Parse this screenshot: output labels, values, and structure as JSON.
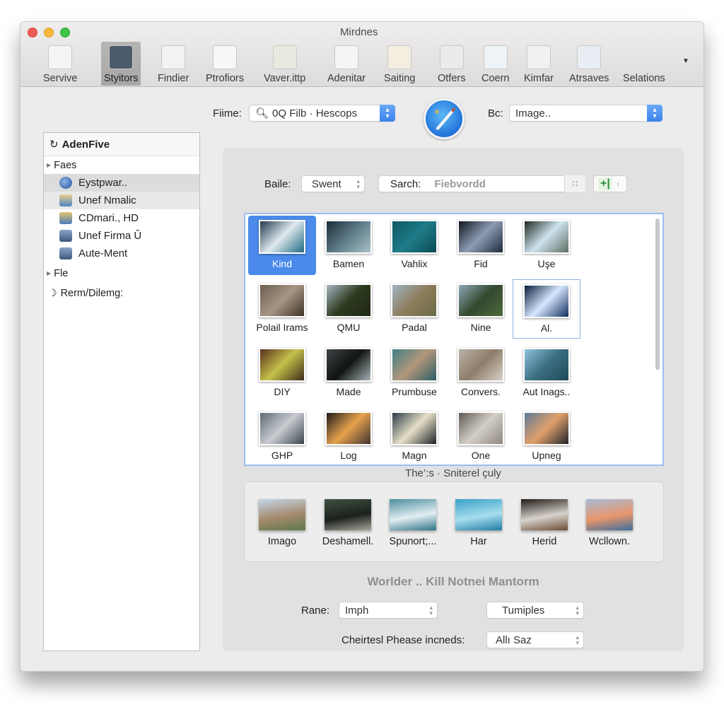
{
  "window": {
    "title": "Mirdnes",
    "traffic_lights": [
      "close",
      "minimize",
      "maximize"
    ]
  },
  "toolbar": {
    "items": [
      {
        "label": "Servive",
        "icon": "document-icon",
        "active": false
      },
      {
        "label": "Styitors",
        "icon": "folder-icon",
        "active": true
      },
      {
        "label": "Findier",
        "icon": "file-list-icon",
        "active": false
      },
      {
        "label": "Ptrofiors",
        "icon": "window-icon",
        "active": false
      },
      {
        "label": "Vaver.ittp",
        "icon": "bag-icon",
        "active": false
      },
      {
        "label": "Adenitar",
        "icon": "notes-icon",
        "active": false
      },
      {
        "label": "Saiting",
        "icon": "palette-icon",
        "active": false
      },
      {
        "label": "Otfers",
        "icon": "envelope-icon",
        "active": false
      },
      {
        "label": "Coern",
        "icon": "presentation-icon",
        "active": false
      },
      {
        "label": "Kimfar",
        "icon": "badge-icon",
        "active": false
      },
      {
        "label": "Atrsaves",
        "icon": "crosshair-icon",
        "active": false
      },
      {
        "label": "Selations",
        "icon": "",
        "active": false
      }
    ],
    "overflow_icon": "chevron-down-icon"
  },
  "filters": {
    "file_label": "Fiime:",
    "file_value": "0Q Filb · Hescops",
    "file_icon": "search-icon",
    "app_icon": "brush-badge-icon",
    "bc_label": "Bc:",
    "bc_value": "Image..",
    "baile_label": "Baile:",
    "baile_value": "Swent",
    "search_label": "Sarch:",
    "search_placeholder": "Fiebvordd",
    "search_icon": "grid-dots-icon",
    "add_button_label": "+|"
  },
  "sidebar": {
    "header": "AdenFive",
    "header_icon": "refresh-icon",
    "groups": [
      {
        "label": "Faes",
        "items": [
          {
            "label": "Eystpwar..",
            "icon": "globe-icon",
            "state": "selected"
          },
          {
            "label": "Unef Nmalic",
            "icon": "folder-icon",
            "state": "highlight"
          },
          {
            "label": "CDmari., HD",
            "icon": "drive-icon",
            "state": ""
          },
          {
            "label": "Unef Firma Ǔ",
            "icon": "disk-icon",
            "state": ""
          },
          {
            "label": "Aute-Ment",
            "icon": "disk-icon",
            "state": ""
          }
        ]
      },
      {
        "label": "Fle",
        "items": []
      }
    ],
    "footer_item": {
      "label": "Rerm/Dilemg:",
      "icon": "moon-icon"
    }
  },
  "grid": {
    "items": [
      {
        "label": "Kind",
        "colors": [
          "#21394f",
          "#dfe9ee",
          "#1e6a80"
        ],
        "state": "selected"
      },
      {
        "label": "Bamen",
        "colors": [
          "#1c2c38",
          "#5d7c88",
          "#a8c0c6"
        ],
        "state": ""
      },
      {
        "label": "Vahlix",
        "colors": [
          "#0f5664",
          "#1e7c88",
          "#0c4a56"
        ],
        "state": ""
      },
      {
        "label": "Fid",
        "colors": [
          "#10161f",
          "#8d9cb3",
          "#1c2b3c"
        ],
        "state": ""
      },
      {
        "label": "Uşe",
        "colors": [
          "#1c2a1e",
          "#cfe2ef",
          "#5b7061"
        ],
        "state": ""
      },
      {
        "label": "Polail Irams",
        "colors": [
          "#6b5e50",
          "#a69684",
          "#3e3326"
        ],
        "state": ""
      },
      {
        "label": "QMU",
        "colors": [
          "#a7b7c1",
          "#2e3a1f",
          "#1e2614"
        ],
        "state": ""
      },
      {
        "label": "Padal",
        "colors": [
          "#9fb3c4",
          "#8e7d5c",
          "#6a6a45"
        ],
        "state": ""
      },
      {
        "label": "Nine",
        "colors": [
          "#8ea7b7",
          "#33482f",
          "#4f6b3a"
        ],
        "state": ""
      },
      {
        "label": "Al.",
        "colors": [
          "#071b3a",
          "#d6e6ff",
          "#0e2e5c"
        ],
        "state": "outlined"
      },
      {
        "label": "DIY",
        "colors": [
          "#5a2f1f",
          "#c5c14a",
          "#3d2a1a"
        ],
        "state": ""
      },
      {
        "label": "Made",
        "colors": [
          "#3e4447",
          "#111511",
          "#a7b3b8"
        ],
        "state": ""
      },
      {
        "label": "Prumbuse",
        "colors": [
          "#3d7e84",
          "#b3977c",
          "#2a5d64"
        ],
        "state": ""
      },
      {
        "label": "Convers.",
        "colors": [
          "#b8b2a7",
          "#8f7d6b",
          "#d7d0c6"
        ],
        "state": ""
      },
      {
        "label": "Aut Inags..",
        "colors": [
          "#8ec2df",
          "#3b6e80",
          "#1f4958"
        ],
        "state": ""
      },
      {
        "label": "GHP",
        "colors": [
          "#5f6b74",
          "#c9ccd1",
          "#3a444c"
        ],
        "state": ""
      },
      {
        "label": "Log",
        "colors": [
          "#1d1a1a",
          "#e7a24c",
          "#3e3431"
        ],
        "state": ""
      },
      {
        "label": "Magn",
        "colors": [
          "#2b3a46",
          "#e6e0c8",
          "#1b2126"
        ],
        "state": ""
      },
      {
        "label": "One",
        "colors": [
          "#5f5a54",
          "#d3cfc7",
          "#8e8780"
        ],
        "state": ""
      },
      {
        "label": "Upneg",
        "colors": [
          "#607a99",
          "#e1a06a",
          "#1f242b"
        ],
        "state": ""
      }
    ],
    "caption": "The’:s · Sniterel çuly"
  },
  "strip": {
    "items": [
      {
        "label": "Imago",
        "colors": [
          "#c4d7e8",
          "#a5896c",
          "#5d7a4a"
        ]
      },
      {
        "label": "Deshamell.",
        "colors": [
          "#3f5142",
          "#1c211d",
          "#a6a59a"
        ]
      },
      {
        "label": "Spunort;...",
        "colors": [
          "#4d8f9f",
          "#e2eef2",
          "#2f7487"
        ]
      },
      {
        "label": "Har",
        "colors": [
          "#3aa2c8",
          "#a7dded",
          "#1f7ea6"
        ]
      },
      {
        "label": "Herid",
        "colors": [
          "#1f1a17",
          "#d8d2cc",
          "#6b4d36"
        ]
      },
      {
        "label": "Wcllown.",
        "colors": [
          "#a8bcd8",
          "#e8966c",
          "#3d6d9c"
        ]
      }
    ]
  },
  "options": {
    "section_title": "Worlder .. Kill Notnei Mantorm",
    "rane_label": "Rane:",
    "rane_value": "Imph",
    "second_value": "Tumiples",
    "cheirtes_label": "Cheirtesl Phease incneds:",
    "cheirtes_value": "Allı Saz"
  }
}
